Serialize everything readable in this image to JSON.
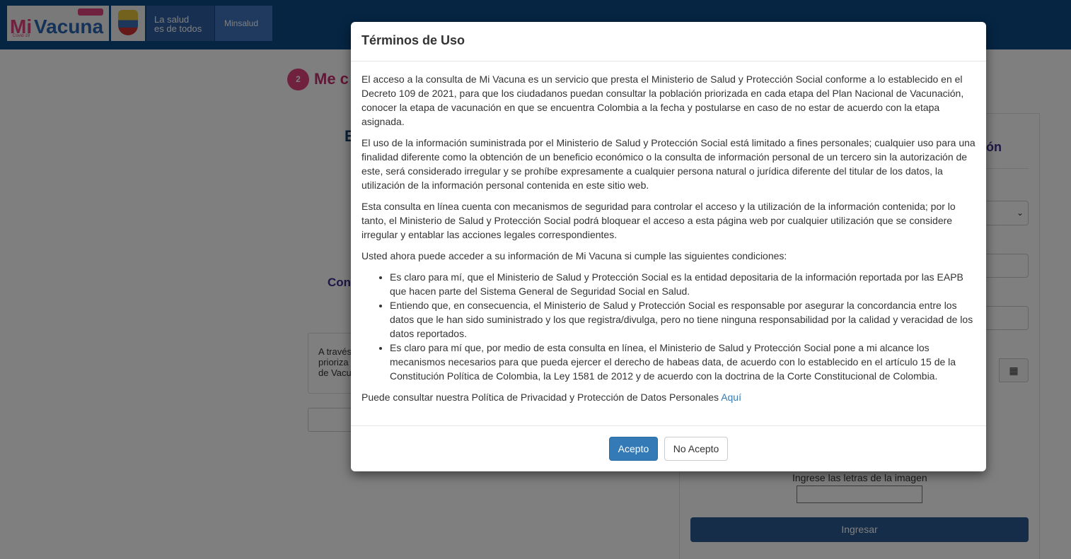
{
  "header": {
    "logo_mi": "Mi",
    "logo_vacuna": "Vacuna",
    "logo_covid": "Covid-19",
    "salud_line1": "La salud",
    "salud_line2": "es de todos",
    "minsalud": "Minsalud"
  },
  "background": {
    "step_number": "2",
    "step_title": "Me c",
    "big_letter": "E",
    "con_text": "Con",
    "info_lines": [
      "A través",
      "prioriza",
      "de Vacu"
    ],
    "panel_title": "ón",
    "select_value": "⌄",
    "calendar_icon": "▦",
    "captcha_label": "Ingrese las letras de la imagen",
    "ingresar_label": "Ingresar"
  },
  "modal": {
    "title": "Términos de Uso",
    "paragraphs": [
      "El acceso a la consulta de Mi Vacuna es un servicio que presta el Ministerio de Salud y Protección Social conforme a lo establecido en el Decreto 109 de 2021, para que los ciudadanos puedan consultar la población priorizada en cada etapa del Plan Nacional de Vacunación, conocer la etapa de vacunación en que se encuentra Colombia a la fecha y postularse en caso de no estar de acuerdo con la etapa asignada.",
      "El uso de la información suministrada por el Ministerio de Salud y Protección Social está limitado a fines personales; cualquier uso para una finalidad diferente como la obtención de un beneficio económico o la consulta de información personal de un tercero sin la autorización de este, será considerado irregular y se prohíbe expresamente a cualquier persona natural o jurídica diferente del titular de los datos, la utilización de la información personal contenida en este sitio web.",
      "Esta consulta en línea cuenta con mecanismos de seguridad para controlar el acceso y la utilización de la información contenida; por lo tanto, el Ministerio de Salud y Protección Social podrá bloquear el acceso a esta página web por cualquier utilización que se considere irregular y entablar las acciones legales correspondientes.",
      "Usted ahora puede acceder a su información de Mi Vacuna si cumple las siguientes condiciones:"
    ],
    "conditions": [
      "Es claro para mí, que el Ministerio de Salud y Protección Social es la entidad depositaria de la información reportada por las EAPB que hacen parte del Sistema General de Seguridad Social en Salud.",
      "Entiendo que, en consecuencia, el Ministerio de Salud y Protección Social es responsable por asegurar la concordancia entre los datos que le han sido suministrado y los que registra/divulga, pero no tiene ninguna responsabilidad por la calidad y veracidad de los datos reportados.",
      "Es claro para mí que, por medio de esta consulta en línea, el Ministerio de Salud y Protección Social pone a mi alcance los mecanismos necesarios para que pueda ejercer el derecho de habeas data, de acuerdo con lo establecido en el artículo 15 de la Constitución Política de Colombia, la Ley 1581 de 2012 y de acuerdo con la doctrina de la Corte Constitucional de Colombia."
    ],
    "privacy_text": "Puede consultar nuestra Política de Privacidad y Protección de Datos Personales ",
    "privacy_link": "Aquí",
    "accept_label": "Acepto",
    "reject_label": "No Acepto"
  }
}
